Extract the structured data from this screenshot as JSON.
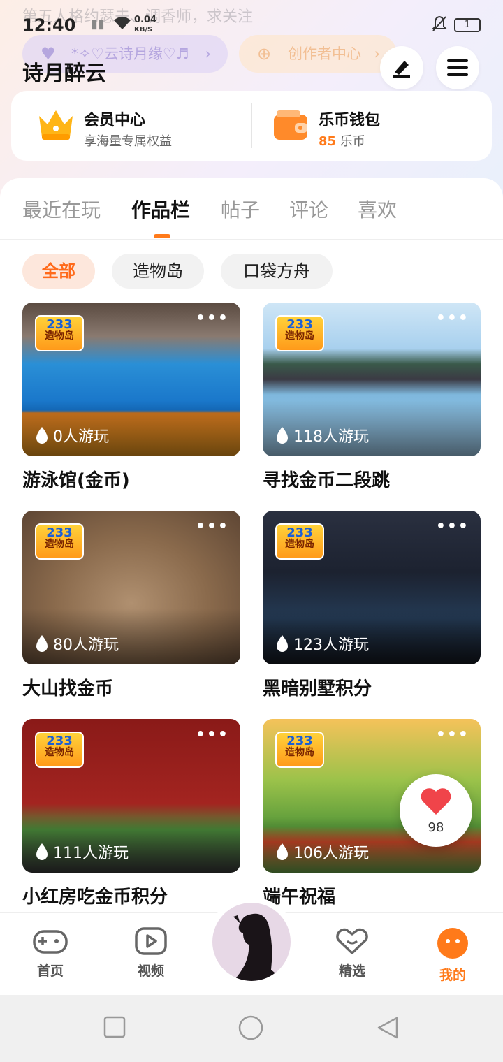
{
  "status_bar": {
    "notification_text": "第五人格约瑟夫、调香师，求关注",
    "time": "12:40",
    "net_speed": "0.04",
    "net_unit": "KB/S",
    "battery": "1"
  },
  "header": {
    "username": "诗月醉云",
    "pill_name": "*✧♡云诗月缘♡♬",
    "pill_creator": "创作者中心"
  },
  "top_card": {
    "member_title": "会员中心",
    "member_sub": "享海量专属权益",
    "wallet_title": "乐币钱包",
    "wallet_amount": "85",
    "wallet_unit": "乐币"
  },
  "tabs": [
    "最近在玩",
    "作品栏",
    "帖子",
    "评论",
    "喜欢"
  ],
  "active_tab": "作品栏",
  "chips": [
    "全部",
    "造物岛",
    "口袋方舟"
  ],
  "badge": {
    "num": "233",
    "name": "造物岛"
  },
  "games": [
    {
      "name": "游泳馆(金币)",
      "plays": "0人游玩"
    },
    {
      "name": "寻找金币二段跳",
      "plays": "118人游玩"
    },
    {
      "name": "大山找金币",
      "plays": "80人游玩"
    },
    {
      "name": "黑暗别墅积分",
      "plays": "123人游玩"
    },
    {
      "name": "小红房吃金币积分",
      "plays": "111人游玩"
    },
    {
      "name": "端午祝福",
      "plays": "106人游玩"
    }
  ],
  "like_count": "98",
  "bottom_nav": [
    "首页",
    "视频",
    "精选",
    "我的"
  ],
  "colors": {
    "accent": "#ff7a1a",
    "chip_active_bg": "#fde7dc"
  }
}
